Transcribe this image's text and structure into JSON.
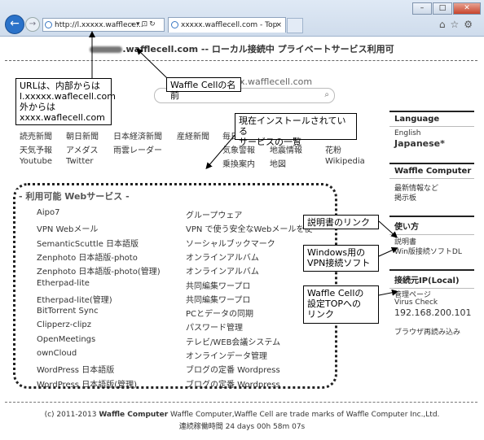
{
  "browser": {
    "address": "http://l.xxxxx.wafflece...",
    "tab_title": "xxxxx.wafflecell.com - Top",
    "close_glyph": "×",
    "win_minimize": "–",
    "win_maximize": "□",
    "win_close": "✕"
  },
  "header": {
    "title_prefix_blur": "xxxxx",
    "title": ".wafflecell.com -- ローカル接続中 プライベートサービス利用可",
    "logo_text": "xxxxx.wafflecell.com"
  },
  "links": [
    [
      "読売新聞",
      "朝日新聞",
      "日本経済新聞",
      "産経新聞",
      "毎日"
    ],
    [
      "天気予報",
      "アメダス",
      "雨雲レーダー",
      "気象警報",
      "地震情報",
      "花粉"
    ],
    [
      "Youtube",
      "Twitter",
      "乗換案内",
      "地図",
      "Wikipedia"
    ]
  ],
  "services": {
    "title": "- 利用可能 Webサービス -",
    "rows": [
      {
        "name": "Aipo7",
        "desc": "グループウェア"
      },
      {
        "name": "VPN Webメール",
        "desc": "VPN で使う安全なWebメールを使"
      },
      {
        "name": "SemanticScuttle 日本語版",
        "desc": "ソーシャルブックマーク"
      },
      {
        "name": "Zenphoto 日本語版-photo",
        "desc": "オンラインアルバム"
      },
      {
        "name": "Zenphoto 日本語版-photo(管理)",
        "desc": "オンラインアルバム"
      },
      {
        "name": "Etherpad-lite",
        "desc": "共同編集ワープロ"
      },
      {
        "name": "Etherpad-lite(管理)",
        "desc": "共同編集ワープロ"
      },
      {
        "name": "BitTorrent Sync",
        "desc": "PCとデータの同期"
      },
      {
        "name": "Clipperz-clipz",
        "desc": "パスワード管理"
      },
      {
        "name": "OpenMeetings",
        "desc": "テレビ/WEB会議システム"
      },
      {
        "name": "ownCloud",
        "desc": "オンラインデータ管理"
      },
      {
        "name": "WordPress 日本語版",
        "desc": "ブログの定番 Wordpress"
      },
      {
        "name": "WordPress 日本語版(管理)",
        "desc": "ブログの定番 Wordpress"
      }
    ]
  },
  "sidebar": {
    "language_head": "Language",
    "language_en": "English",
    "language_ja": "Japanese*",
    "waffle_head": "Waffle Computer",
    "waffle_item1": "最新情報など",
    "waffle_item2": "掲示板",
    "usage_head": "使い方",
    "usage_item1": "説明書",
    "usage_item2": "Win版接続ソフトDL",
    "ip_head": "接続元IP(Local)",
    "ip_item1": "管理ページ",
    "ip_item2": "Virus Check",
    "ip_value": "192.168.200.101",
    "reload": "ブラウザ再読み込み"
  },
  "footer": {
    "copyright_prefix": "(c) 2011-2013 ",
    "copyright_brand": "Waffle Computer",
    "copyright_rest": " Waffle Computer,Waffle Cell are trade marks of Waffle Computer Inc.,Ltd.",
    "uptime": "連続稼働時間 24 days 00h 58m 07s"
  },
  "callouts": {
    "url_note_1": "URLは、内部からは",
    "url_note_2": "l.xxxxx.waflecell.com",
    "url_note_3": "外からは",
    "url_note_4": "xxxx.waflecell.com",
    "cell_name": "Waffle Cellの名前",
    "installed_1": "現在インストールされている",
    "installed_2": "サービスの一覧",
    "manual_link": "説明書のリンク",
    "vpn_1": "Windows用の",
    "vpn_2": "VPN接続ソフト",
    "settop_1": "Waffle Cellの",
    "settop_2": "設定TOPへの",
    "settop_3": "リンク"
  }
}
